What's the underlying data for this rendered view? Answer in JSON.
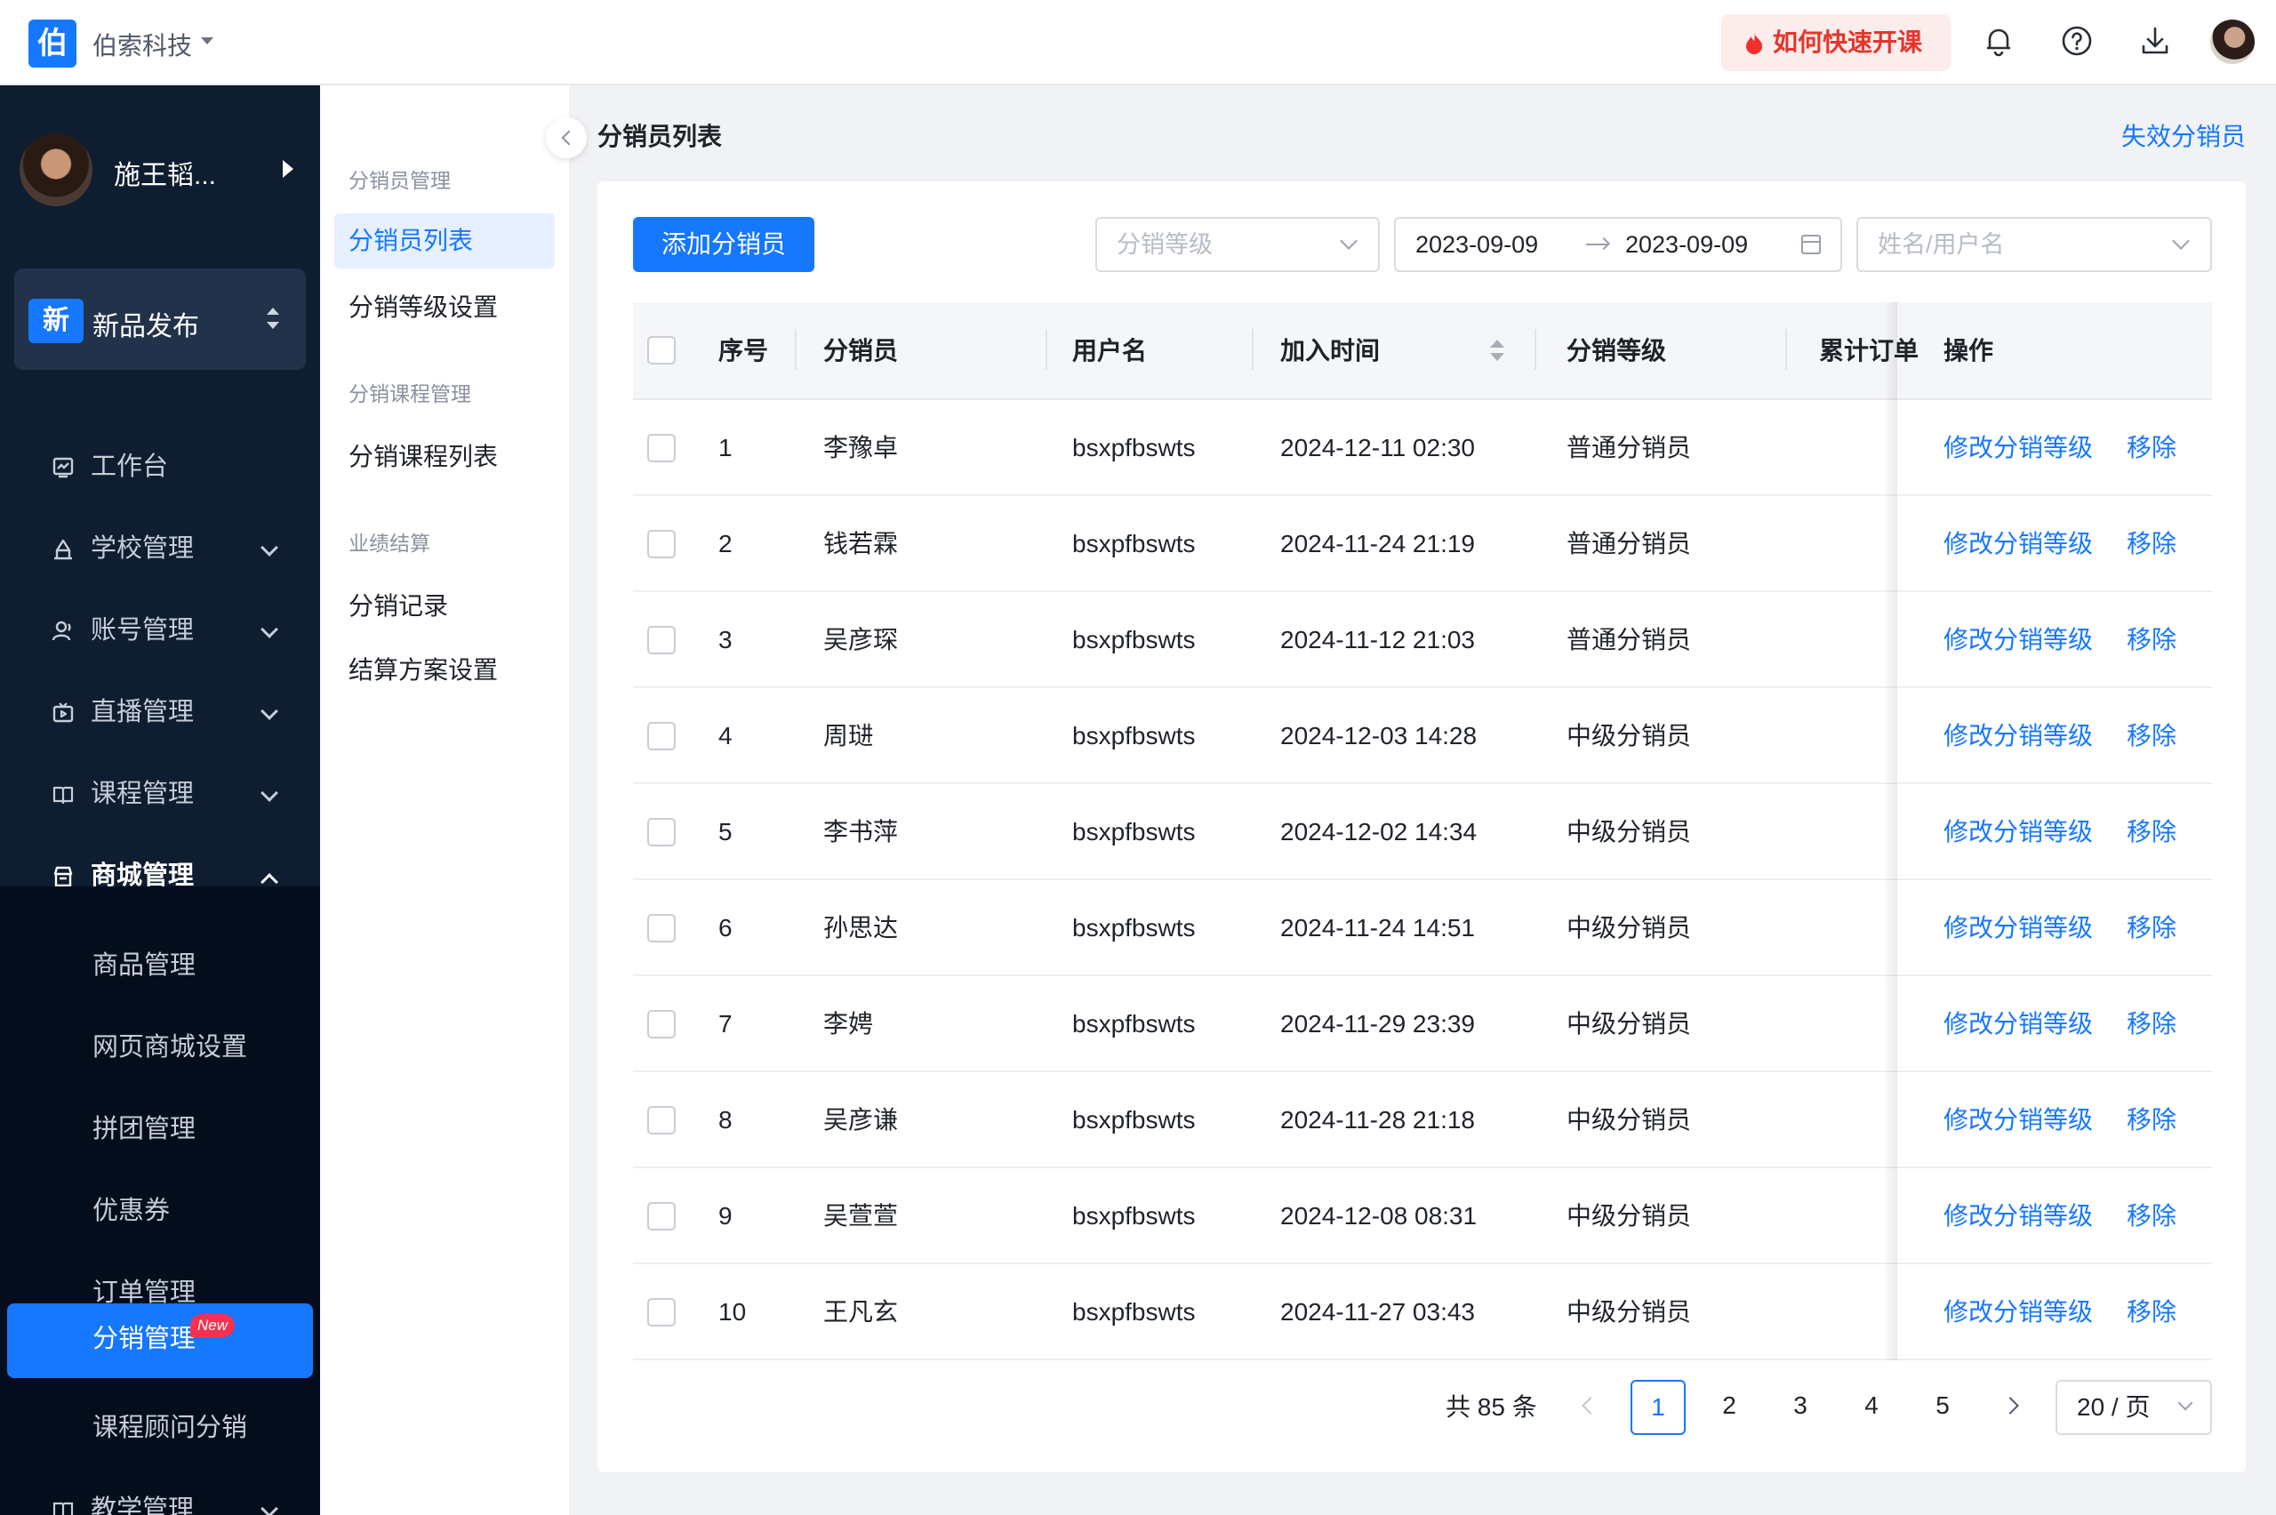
{
  "header": {
    "logo_char": "伯",
    "org_name": "伯索科技",
    "promo_label": "如何快速开课",
    "icons": [
      "bell-icon",
      "help-icon",
      "download-icon",
      "avatar"
    ]
  },
  "sidebar": {
    "user_name": "施王韬...",
    "product": {
      "badge": "新",
      "name": "新品发布"
    },
    "items": [
      {
        "label": "工作台",
        "icon": "dashboard-icon"
      },
      {
        "label": "学校管理",
        "icon": "school-icon"
      },
      {
        "label": "账号管理",
        "icon": "account-icon"
      },
      {
        "label": "直播管理",
        "icon": "live-icon"
      },
      {
        "label": "课程管理",
        "icon": "course-icon"
      },
      {
        "label": "商城管理",
        "icon": "store-icon"
      }
    ],
    "sub_items": [
      {
        "label": "商品管理"
      },
      {
        "label": "网页商城设置"
      },
      {
        "label": "拼团管理"
      },
      {
        "label": "优惠券"
      },
      {
        "label": "订单管理"
      },
      {
        "label": "分销管理",
        "tag": "New"
      },
      {
        "label": "课程顾问分销"
      }
    ],
    "more_label": "教学管理"
  },
  "subnav": {
    "group1": "分销员管理",
    "link1": "分销员列表",
    "link2": "分销等级设置",
    "group2": "分销课程管理",
    "link3": "分销课程列表",
    "group3": "业绩结算",
    "link4": "分销记录",
    "link5": "结算方案设置"
  },
  "main": {
    "title": "分销员列表",
    "invalid_link": "失效分销员",
    "add_button": "添加分销员",
    "level_select_placeholder": "分销等级",
    "date_start": "2023-09-09",
    "date_end": "2023-09-09",
    "search_placeholder": "姓名/用户名"
  },
  "table": {
    "columns": [
      "序号",
      "分销员",
      "用户名",
      "加入时间",
      "分销等级",
      "累计订单",
      "操作"
    ],
    "op_edit": "修改分销等级",
    "op_remove": "移除",
    "rows": [
      {
        "no": "1",
        "name": "李豫卓",
        "user": "bsxpfbswts",
        "time": "2024-12-11 02:30",
        "level": "普通分销员"
      },
      {
        "no": "2",
        "name": "钱若霖",
        "user": "bsxpfbswts",
        "time": "2024-11-24 21:19",
        "level": "普通分销员"
      },
      {
        "no": "3",
        "name": "吴彦琛",
        "user": "bsxpfbswts",
        "time": "2024-11-12 21:03",
        "level": "普通分销员"
      },
      {
        "no": "4",
        "name": "周琎",
        "user": "bsxpfbswts",
        "time": "2024-12-03 14:28",
        "level": "中级分销员"
      },
      {
        "no": "5",
        "name": "李书萍",
        "user": "bsxpfbswts",
        "time": "2024-12-02 14:34",
        "level": "中级分销员"
      },
      {
        "no": "6",
        "name": "孙思达",
        "user": "bsxpfbswts",
        "time": "2024-11-24 14:51",
        "level": "中级分销员"
      },
      {
        "no": "7",
        "name": "李娉",
        "user": "bsxpfbswts",
        "time": "2024-11-29 23:39",
        "level": "中级分销员"
      },
      {
        "no": "8",
        "name": "吴彦谦",
        "user": "bsxpfbswts",
        "time": "2024-11-28 21:18",
        "level": "中级分销员"
      },
      {
        "no": "9",
        "name": "吴萱萱",
        "user": "bsxpfbswts",
        "time": "2024-12-08 08:31",
        "level": "中级分销员"
      },
      {
        "no": "10",
        "name": "王凡玄",
        "user": "bsxpfbswts",
        "time": "2024-11-27 03:43",
        "level": "中级分销员"
      }
    ]
  },
  "pagination": {
    "total": "共 85 条",
    "pages": [
      "1",
      "2",
      "3",
      "4",
      "5"
    ],
    "current": "1",
    "page_size": "20 / 页"
  },
  "colors": {
    "primary": "#1677ff",
    "sidebar": "#0e1d30",
    "promo": "#e5352b"
  }
}
